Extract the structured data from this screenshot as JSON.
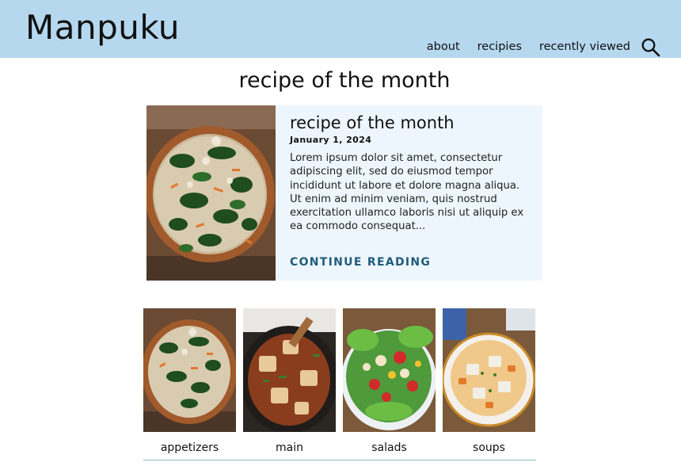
{
  "header": {
    "logo": "Manpuku",
    "nav": [
      {
        "label": "about"
      },
      {
        "label": "recipies"
      },
      {
        "label": "recently viewed"
      }
    ]
  },
  "page_title": "recipe of the month",
  "featured": {
    "title": "recipe of the month",
    "date": "January 1, 2024",
    "excerpt": "Lorem ipsum dolor sit amet, consectetur adipiscing elit, sed do eiusmod tempor incididunt ut labore et dolore magna aliqua. Ut enim ad minim veniam, quis nostrud exercitation ullamco laboris nisi ut aliquip ex ea commodo consequat...",
    "cta": "CONTINUE READING"
  },
  "categories": [
    {
      "label": "appetizers"
    },
    {
      "label": "main"
    },
    {
      "label": "salads"
    },
    {
      "label": "soups"
    }
  ],
  "colors": {
    "header_bg": "#b5d8ef",
    "card_bg": "#eef6fd",
    "cta": "#1f5c7c"
  }
}
